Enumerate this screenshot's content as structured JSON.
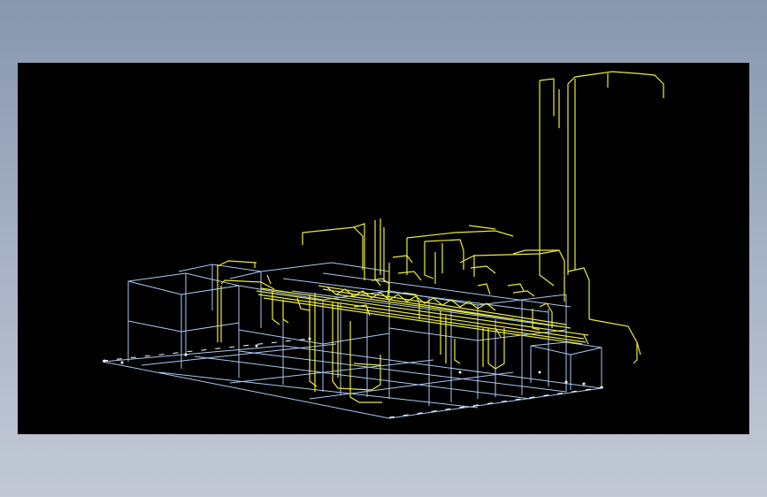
{
  "scene": {
    "background_color": "#000000",
    "frame_color": "#8797ae",
    "structure_color": "#aac8f2",
    "pipe_color": "#ecec3a",
    "highlight_color": "#ffffff"
  }
}
